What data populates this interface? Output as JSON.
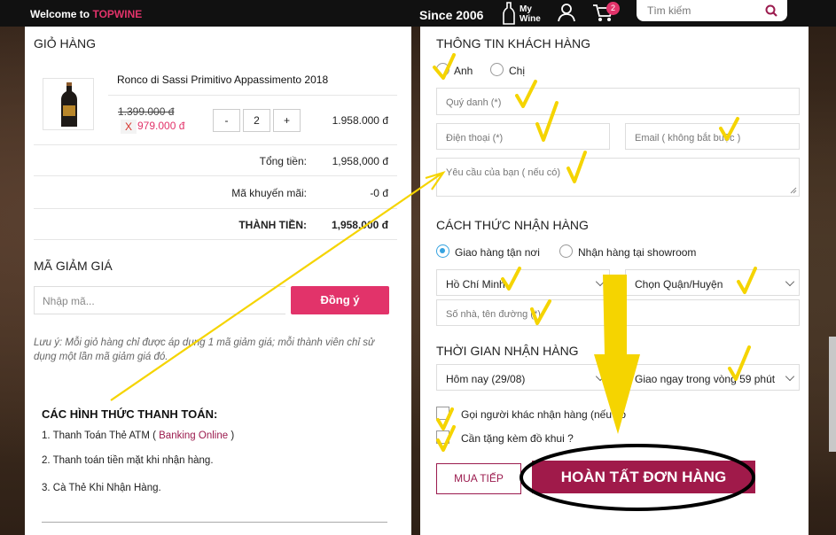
{
  "topbar": {
    "welcome_prefix": "Welcome to ",
    "brand": "TOPWINE",
    "since": "Since 2006",
    "mywine_line1": "My",
    "mywine_line2": "Wine",
    "cart_count": "2",
    "search_placeholder": "Tìm kiếm"
  },
  "cart": {
    "title": "GIỎ HÀNG",
    "product_name": "Ronco di Sassi Primitivo Appassimento 2018",
    "old_price": "1.399.000 đ",
    "remove_label": "X",
    "new_price": "979.000 đ",
    "qty_minus": "-",
    "qty": "2",
    "qty_plus": "+",
    "line_total": "1.958.000 đ",
    "subtotal_label": "Tổng tiền:",
    "subtotal_value": "1,958,000 đ",
    "discount_label": "Mã khuyến mãi:",
    "discount_value": "-0 đ",
    "total_label": "THÀNH TIỀN:",
    "total_value": "1,958,000 đ"
  },
  "coupon": {
    "title": "MÃ GIẢM GIÁ",
    "placeholder": "Nhập mã...",
    "button": "Đồng ý",
    "note": "Lưu ý: Mỗi giỏ hàng chỉ được áp dụng 1 mã giảm giá; mỗi thành viên chỉ sử dụng một lần mã giảm giá đó."
  },
  "payment": {
    "title": "CÁC HÌNH THỨC THANH TOÁN:",
    "m1_prefix": "1. Thanh Toán Thẻ ATM ( ",
    "m1_link": "Banking Online",
    "m1_suffix": " )",
    "m2": "2. Thanh toán tiền mặt khi nhận hàng.",
    "m3": "3. Cà Thẻ Khi Nhận Hàng."
  },
  "customer": {
    "title": "THÔNG TIN KHÁCH HÀNG",
    "opt_anh": "Anh",
    "opt_chi": "Chị",
    "name_ph": "Quý danh (*)",
    "phone_ph": "Điện thoại (*)",
    "email_ph": "Email ( không bắt buộc )",
    "request_ph": "Yêu cầu của bạn ( nếu có)"
  },
  "delivery": {
    "title": "CÁCH THỨC NHẬN HÀNG",
    "opt_home": "Giao hàng tận nơi",
    "opt_showroom": "Nhận hàng tại showroom",
    "city": "Hồ Chí Minh",
    "district": "Chọn Quận/Huyện",
    "address_ph": "Số nhà, tên đường (*)"
  },
  "time": {
    "title": "THỜI GIAN NHẬN HÀNG",
    "day": "Hôm nay (29/08)",
    "slot": "Giao ngay trong vòng 59 phút",
    "other_receiver": "Gọi người khác nhận hàng (nếu có)",
    "opener": "Cần tặng kèm đồ khui ?"
  },
  "actions": {
    "continue": "MUA TIẾP",
    "complete": "HOÀN TẤT ĐƠN HÀNG"
  },
  "colors": {
    "accent": "#e2336a",
    "brand_dark": "#a01a4a",
    "annotation": "#f5d400"
  }
}
